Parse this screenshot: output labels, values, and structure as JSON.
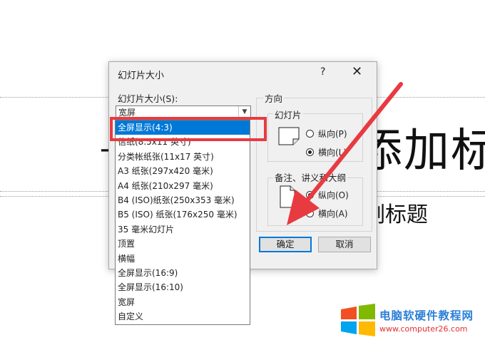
{
  "slide": {
    "title_lead": "-",
    "title": "添加标",
    "subtitle": "副标题"
  },
  "dialog": {
    "title": "幻灯片大小",
    "help_icon": "?",
    "close_icon": "✕",
    "size_label": "幻灯片大小(S):",
    "size_value": "宽屏",
    "dropdown_items": [
      "全屏显示(4:3)",
      "信纸(8.5x11 英寸)",
      "分类帐纸张(11x17 英寸)",
      "A3 纸张(297x420 毫米)",
      "A4 纸张(210x297 毫米)",
      "B4 (ISO)纸张(250x353 毫米)",
      "B5 (ISO) 纸张(176x250 毫米)",
      "35 毫米幻灯片",
      "顶置",
      "横幅",
      "全屏显示(16:9)",
      "全屏显示(16:10)",
      "宽屏",
      "自定义"
    ],
    "selected_index": 0,
    "orientation_label": "方向",
    "slides_group_label": "幻灯片",
    "slides_portrait": "纵向(P)",
    "slides_landscape": "横向(L)",
    "notes_group_label": "备注、讲义和大纲",
    "notes_portrait": "纵向(O)",
    "notes_landscape": "横向(A)",
    "ok_label": "确定",
    "cancel_label": "取消"
  },
  "watermark": {
    "text_cn": "电脑软硬件教程网",
    "url": "www.computer26.com"
  },
  "colors": {
    "selection_blue": "#0078d7",
    "annotation_red": "#e83a41"
  }
}
